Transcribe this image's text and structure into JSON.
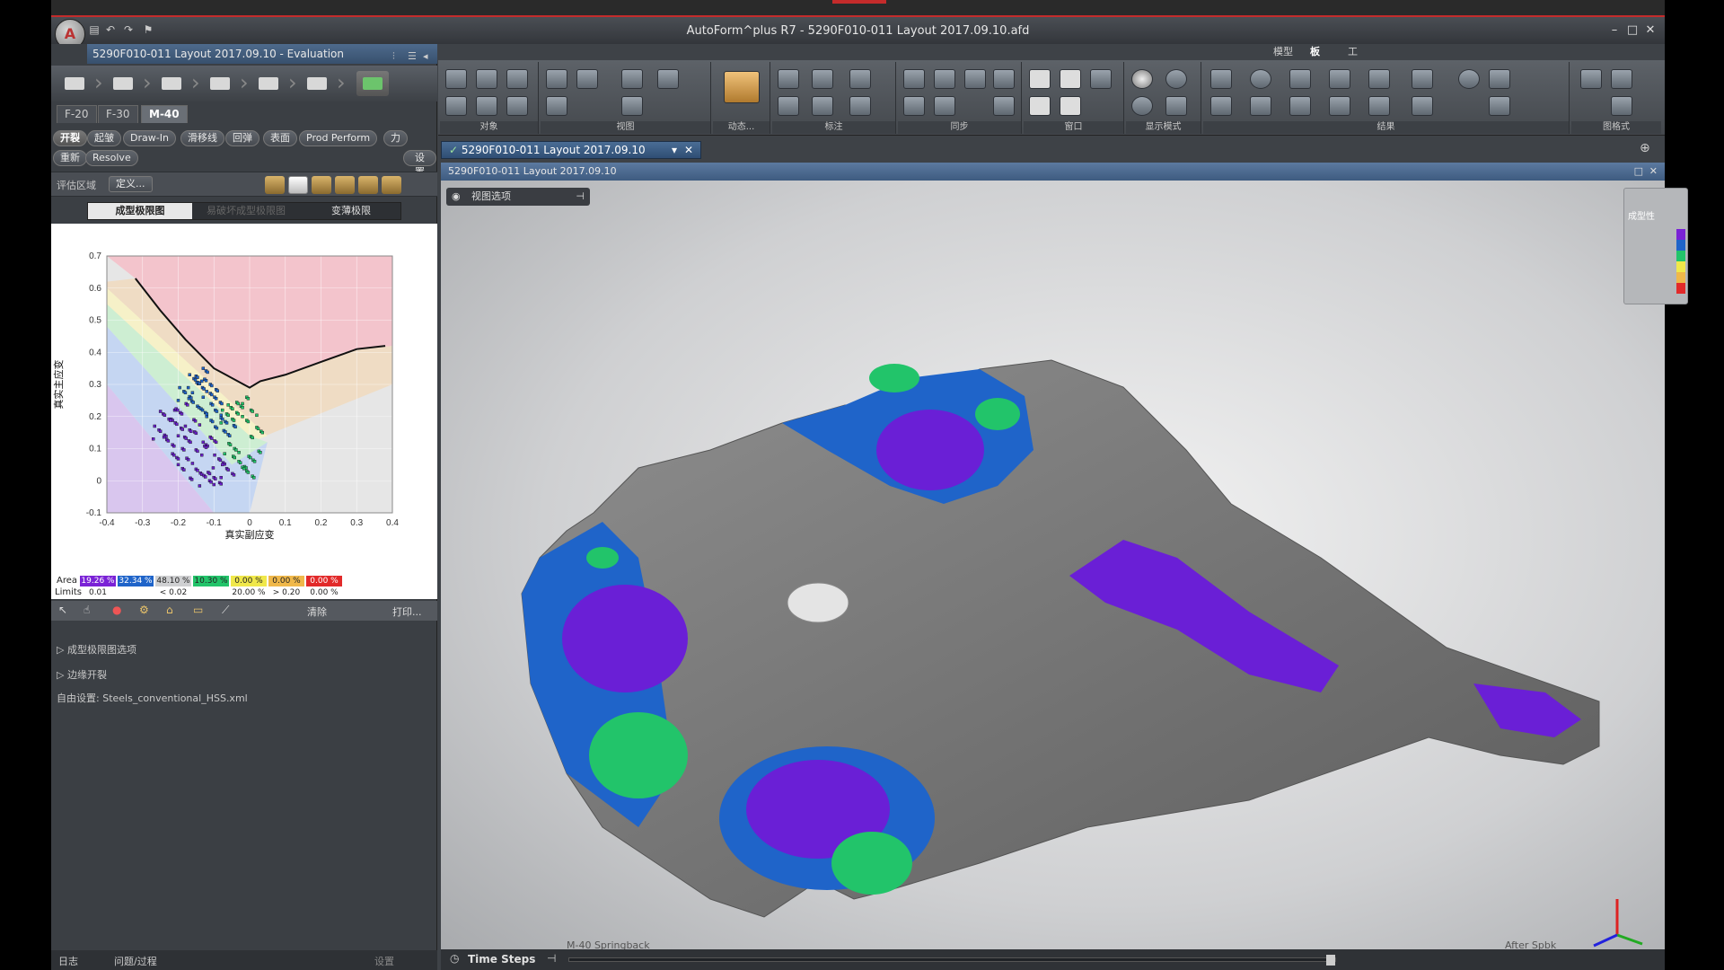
{
  "window": {
    "title": "AutoForm^plus R7 - 5290F010-011  Layout 2017.09.10.afd",
    "document": "5290F010-011  Layout 2017.09.10 - Evaluation",
    "brand_color": "#c42b2b"
  },
  "quick_access": {
    "icons": [
      "save-icon",
      "undo-icon",
      "redo-icon",
      "plot-icon"
    ]
  },
  "left_panel": {
    "tabs": [
      "F-20",
      "F-30",
      "M-40"
    ],
    "active_tab": "M-40",
    "pills_row1": [
      "开裂",
      "起皱",
      "Draw-In",
      "滑移线",
      "回弹",
      "表面",
      "Prod Perform",
      "力"
    ],
    "pills_row2": [
      "重新",
      "Resolve"
    ],
    "settings_label": "设置",
    "eval_area_label": "评估区域",
    "define_label": "定义...",
    "subtabs": [
      "成型极限图",
      "易破坏成型极限图",
      "变薄极限"
    ],
    "active_subtab": "成型极限图",
    "chart_ylabel": "真实主应变",
    "chart_xlabel": "真实副应变",
    "legend": {
      "area_label": "Area",
      "limits_label": "Limits",
      "cells": [
        {
          "area": "19.26 %",
          "limit": "0.01",
          "color": "#7a22d6"
        },
        {
          "area": "32.34 %",
          "limit": "",
          "color": "#1f64c9"
        },
        {
          "area": "48.10 %",
          "limit": "< 0.02",
          "color": "#cfd0d2"
        },
        {
          "area": "10.30 %",
          "limit": "",
          "color": "#22c46a"
        },
        {
          "area": "0.00 %",
          "limit": "20.00 %",
          "color": "#f0e84a"
        },
        {
          "area": "0.00 %",
          "limit": "> 0.20",
          "color": "#f0b84a"
        },
        {
          "area": "0.00 %",
          "limit": "0.00 %",
          "color": "#e22a2a"
        }
      ]
    },
    "tools2": {
      "clear": "清除",
      "print": "打印..."
    },
    "sections": [
      "成型极限图选项",
      "边缘开裂"
    ],
    "material_label": "自由设置:",
    "material_value": "Steels_conventional_HSS.xml",
    "bottom_tabs": [
      "日志",
      "问题/过程"
    ],
    "bottom_right": "设置"
  },
  "chart_data": {
    "type": "scatter",
    "title": "",
    "xlabel": "真实副应变",
    "ylabel": "真实主应变",
    "xlim": [
      -0.4,
      0.4
    ],
    "ylim": [
      -0.1,
      0.7
    ],
    "x_ticks": [
      "-0.4",
      "-0.3",
      "-0.2",
      "-0.1",
      "0",
      "0.1",
      "0.2",
      "0.3",
      "0.4"
    ],
    "y_ticks": [
      "-0.1",
      "0",
      "0.1",
      "0.2",
      "0.3",
      "0.4",
      "0.5",
      "0.6",
      "0.7"
    ],
    "series": [
      {
        "name": "",
        "type": "line",
        "color": "#111111",
        "x": [
          -0.32,
          -0.25,
          -0.18,
          -0.1,
          0,
          0.03,
          0.1,
          0.2,
          0.3,
          0.38
        ],
        "y": [
          0.63,
          0.53,
          0.44,
          0.35,
          0.29,
          0.31,
          0.33,
          0.37,
          0.41,
          0.42
        ]
      },
      {
        "name": "",
        "type": "scatter",
        "color": "#6a20cc",
        "x": [
          -0.25,
          -0.22,
          -0.2,
          -0.18,
          -0.15,
          -0.12,
          -0.1,
          -0.2,
          -0.17,
          -0.13,
          -0.09,
          -0.06,
          -0.23,
          -0.19,
          -0.16,
          -0.11
        ],
        "y": [
          0.15,
          0.12,
          0.08,
          0.05,
          0.02,
          0.0,
          0.01,
          0.18,
          0.14,
          0.1,
          0.06,
          0.03,
          0.2,
          0.22,
          0.17,
          0.12
        ]
      },
      {
        "name": "",
        "type": "scatter",
        "color": "#1f64c9",
        "x": [
          -0.18,
          -0.15,
          -0.12,
          -0.1,
          -0.08,
          -0.14,
          -0.11,
          -0.09,
          -0.06,
          -0.13,
          -0.16
        ],
        "y": [
          0.27,
          0.24,
          0.22,
          0.2,
          0.18,
          0.29,
          0.3,
          0.26,
          0.16,
          0.33,
          0.31
        ]
      },
      {
        "name": "",
        "type": "scatter",
        "color": "#22c46a",
        "x": [
          -0.06,
          -0.04,
          -0.02,
          0.0,
          0.02,
          -0.05,
          -0.03,
          0.0,
          0.01
        ],
        "y": [
          0.2,
          0.22,
          0.24,
          0.2,
          0.15,
          0.1,
          0.06,
          0.03,
          0.08
        ]
      }
    ],
    "regions": [
      {
        "name": "red",
        "color": "#f3c4cc"
      },
      {
        "name": "tan",
        "color": "#efdcc4"
      },
      {
        "name": "yellow",
        "color": "#f6f1c8"
      },
      {
        "name": "green",
        "color": "#cdeed2"
      },
      {
        "name": "blue",
        "color": "#c5d6f2"
      },
      {
        "name": "purple",
        "color": "#d9c6ee"
      },
      {
        "name": "grey",
        "color": "#e6e6e6"
      }
    ]
  },
  "ribbon": {
    "tabs": [
      "模型",
      "板料",
      "工具"
    ],
    "active_tab": "板料",
    "groups": [
      "对象",
      "视图",
      "动态...",
      "标注",
      "同步",
      "窗口",
      "显示模式",
      "结果",
      "图格式"
    ]
  },
  "document_tab": "5290F010-011  Layout 2017.09.10",
  "viewport": {
    "header": "5290F010-011 Layout 2017.09.10",
    "view_options": "视图选项",
    "legend_title": "成型性",
    "legend_colors": [
      "#7a22d6",
      "#1f64c9",
      "#22c46a",
      "#f0e84a",
      "#f0b84a",
      "#e22a2a"
    ],
    "step_label": "M-40 Springback",
    "after_label": "After Spbk",
    "time_steps_label": "Time Steps"
  }
}
